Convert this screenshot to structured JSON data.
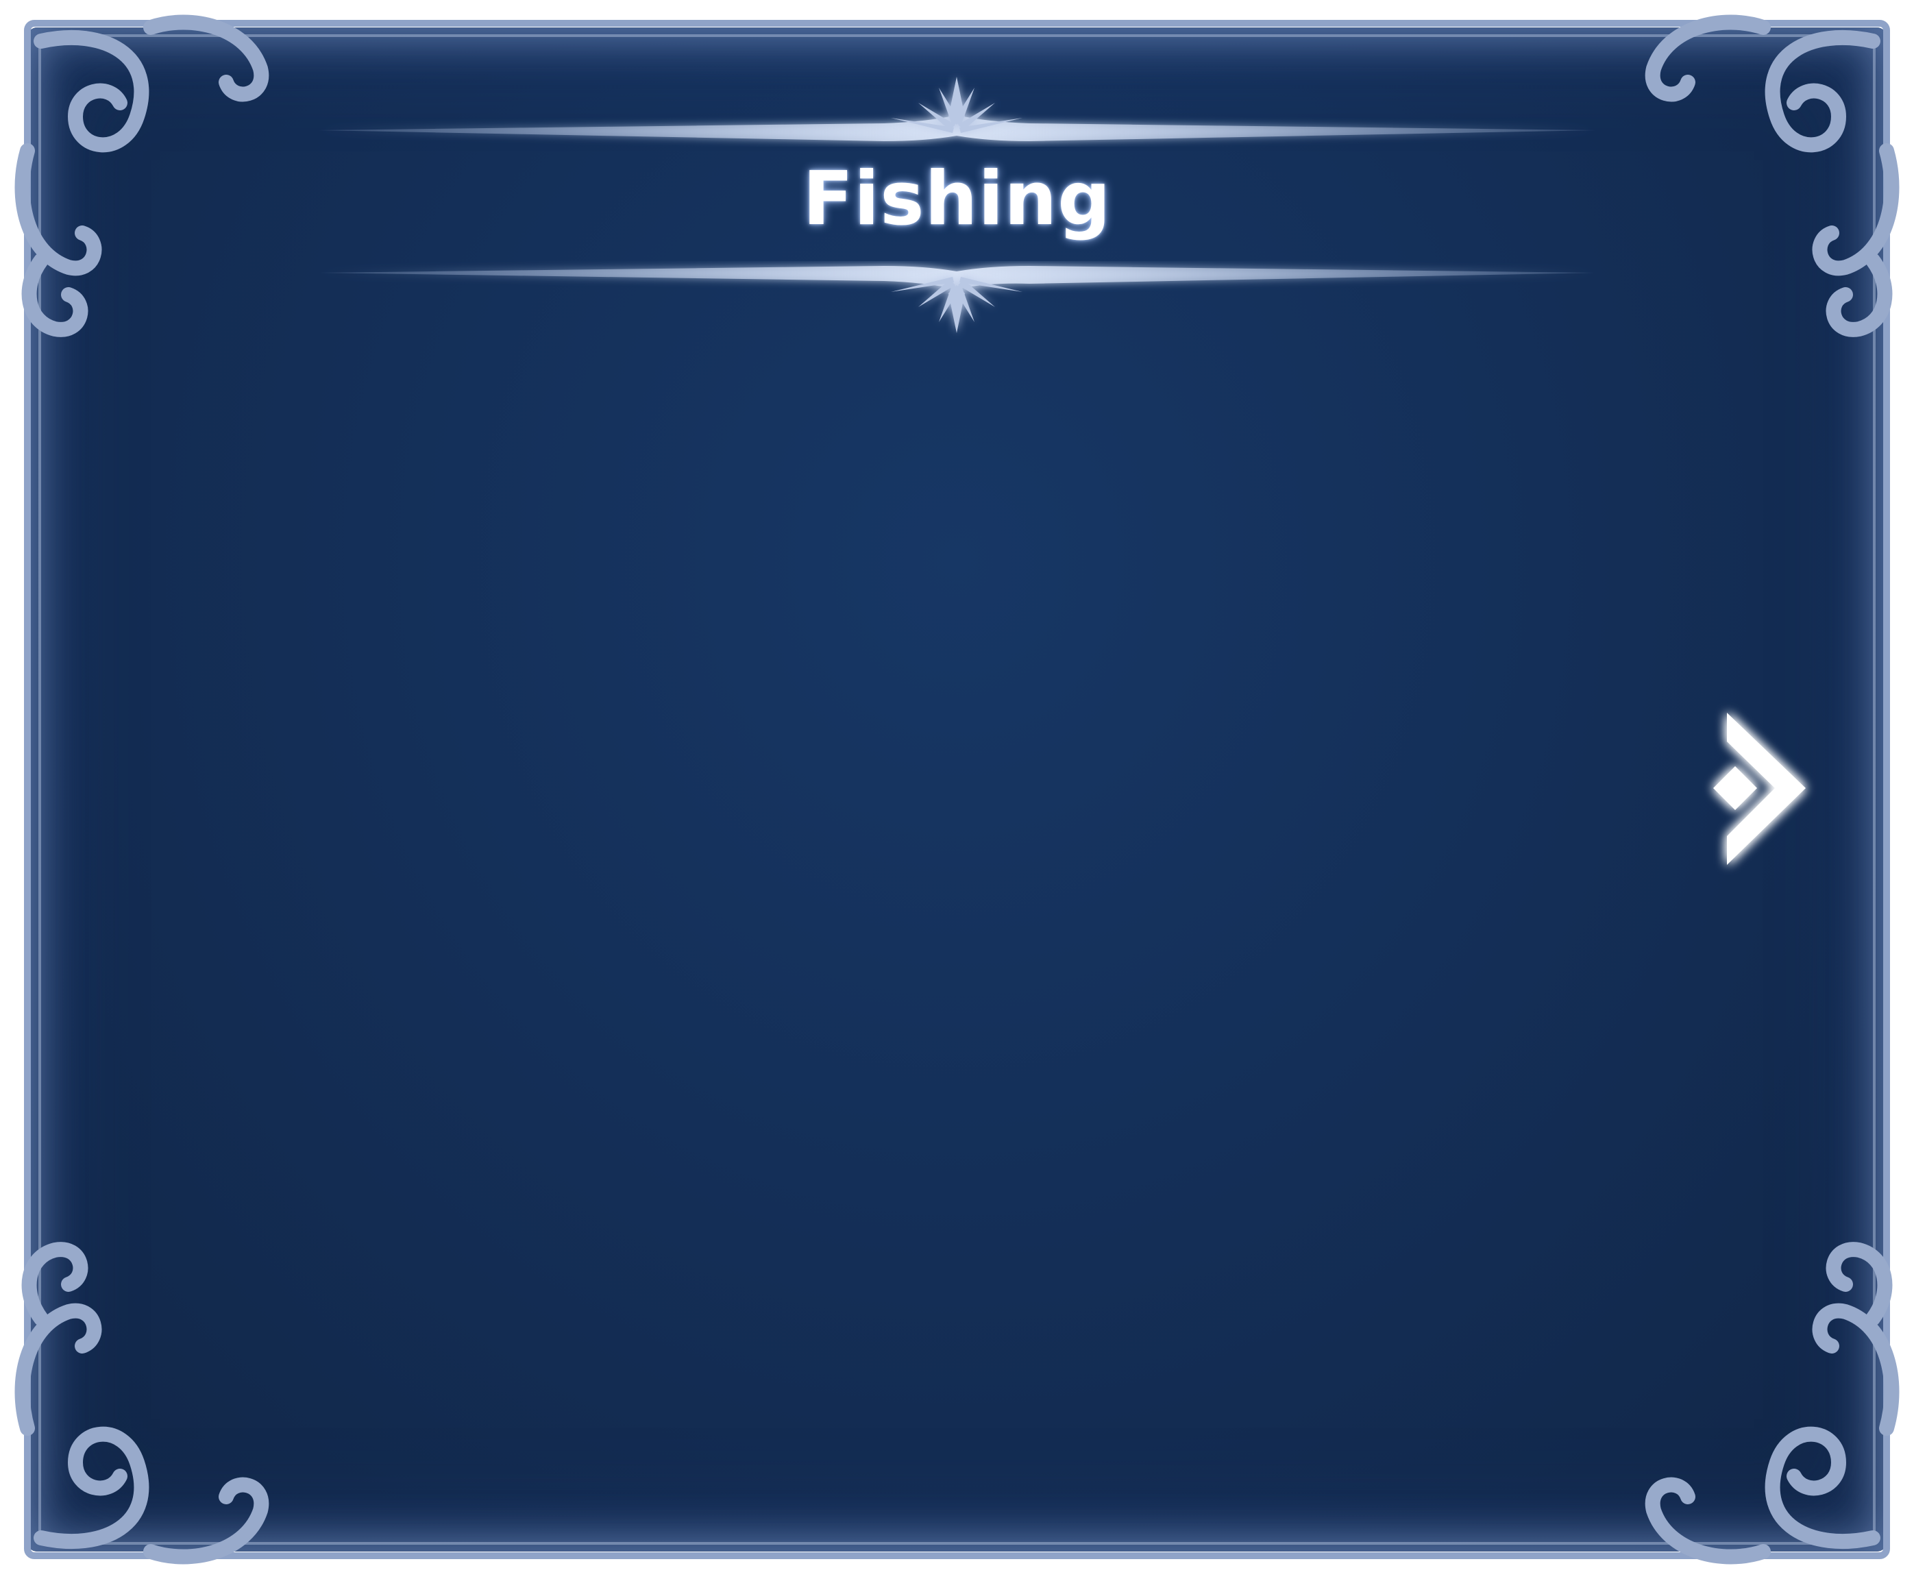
{
  "panel": {
    "title": "Fishing",
    "background_color": "#142f58",
    "frame_color": "#8fa3c8"
  },
  "controls": {
    "next_icon": "chevron-right-icon"
  }
}
